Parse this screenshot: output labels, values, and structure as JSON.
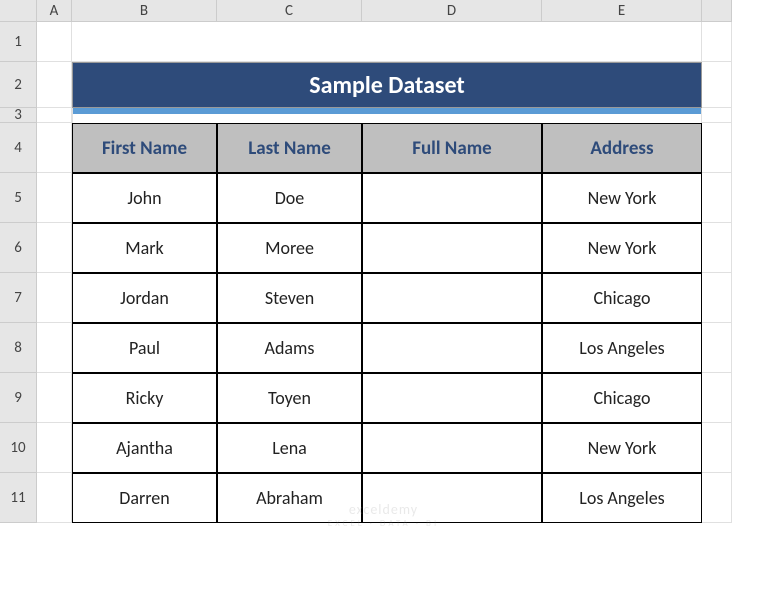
{
  "columns": [
    "A",
    "B",
    "C",
    "D",
    "E"
  ],
  "rows": [
    "1",
    "2",
    "3",
    "4",
    "5",
    "6",
    "7",
    "8",
    "9",
    "10",
    "11"
  ],
  "title": "Sample Dataset",
  "headers": {
    "first_name": "First Name",
    "last_name": "Last Name",
    "full_name": "Full Name",
    "address": "Address"
  },
  "chart_data": {
    "type": "table",
    "title": "Sample Dataset",
    "columns": [
      "First Name",
      "Last Name",
      "Full Name",
      "Address"
    ],
    "rows": [
      {
        "first_name": "John",
        "last_name": "Doe",
        "full_name": "",
        "address": "New York"
      },
      {
        "first_name": "Mark",
        "last_name": "Moree",
        "full_name": "",
        "address": "New York"
      },
      {
        "first_name": "Jordan",
        "last_name": "Steven",
        "full_name": "",
        "address": "Chicago"
      },
      {
        "first_name": "Paul",
        "last_name": "Adams",
        "full_name": "",
        "address": "Los Angeles"
      },
      {
        "first_name": "Ricky",
        "last_name": "Toyen",
        "full_name": "",
        "address": "Chicago"
      },
      {
        "first_name": "Ajantha",
        "last_name": "Lena",
        "full_name": "",
        "address": "New York"
      },
      {
        "first_name": "Darren",
        "last_name": "Abraham",
        "full_name": "",
        "address": "Los Angeles"
      }
    ]
  },
  "watermark": {
    "main": "exceldemy",
    "sub": "EXCEL · DATA · BI"
  }
}
